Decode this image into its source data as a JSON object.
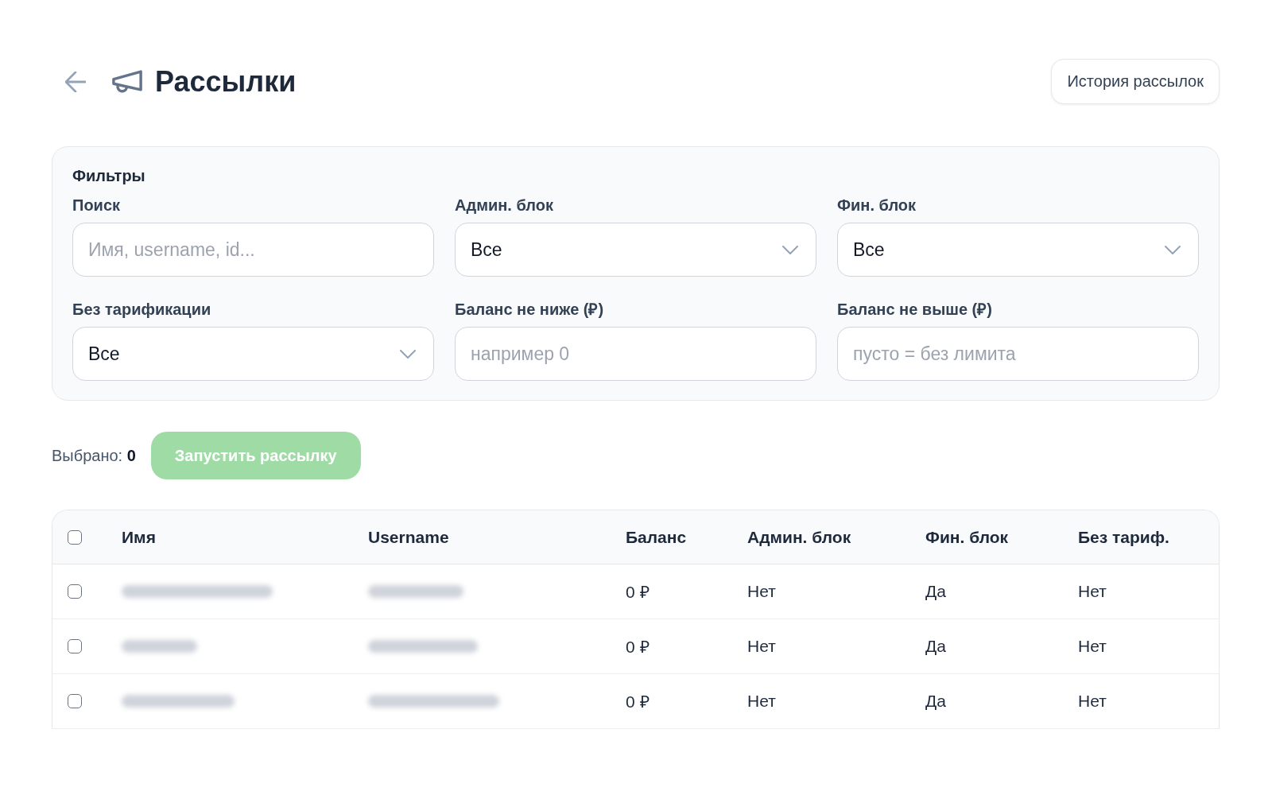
{
  "header": {
    "title": "Рассылки",
    "history_button": "История рассылок"
  },
  "filters": {
    "title": "Фильтры",
    "fields": [
      {
        "kind": "text",
        "label": "Поиск",
        "placeholder": "Имя, username, id..."
      },
      {
        "kind": "select",
        "label": "Админ. блок",
        "value": "Все"
      },
      {
        "kind": "select",
        "label": "Фин. блок",
        "value": "Все"
      },
      {
        "kind": "select",
        "label": "Без тарификации",
        "value": "Все"
      },
      {
        "kind": "text",
        "label": "Баланс не ниже (₽)",
        "placeholder": "например 0"
      },
      {
        "kind": "text",
        "label": "Баланс не выше (₽)",
        "placeholder": "пусто = без лимита"
      }
    ]
  },
  "selection": {
    "summary": "Выбрано: **0**",
    "launch_button": {
      "label": "Запустить рассылку",
      "disabled": true
    }
  },
  "table": {
    "select_all": {
      "checked": false
    },
    "columns": [
      "Имя",
      "Username",
      "Баланс",
      "Админ. блок",
      "Фин. блок",
      "Без тариф."
    ],
    "rows": [
      {
        "checked": false,
        "balance": "0 ₽",
        "admin_block": "Нет",
        "fin_block": "Да",
        "no_tariff": "Нет"
      },
      {
        "checked": false,
        "balance": "0 ₽",
        "admin_block": "Нет",
        "fin_block": "Да",
        "no_tariff": "Нет"
      },
      {
        "checked": false,
        "balance": "0 ₽",
        "admin_block": "Нет",
        "fin_block": "Да",
        "no_tariff": "Нет"
      }
    ]
  }
}
